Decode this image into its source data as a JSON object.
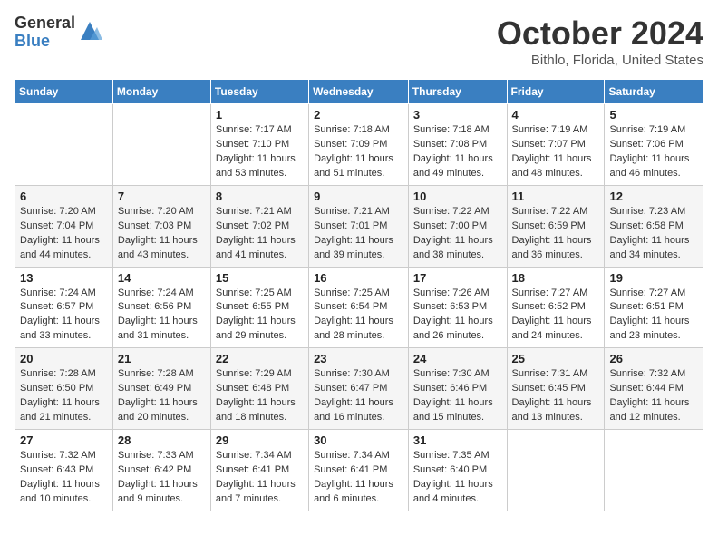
{
  "logo": {
    "general": "General",
    "blue": "Blue"
  },
  "title": {
    "month": "October 2024",
    "location": "Bithlo, Florida, United States"
  },
  "weekdays": [
    "Sunday",
    "Monday",
    "Tuesday",
    "Wednesday",
    "Thursday",
    "Friday",
    "Saturday"
  ],
  "weeks": [
    [
      {
        "day": "",
        "sunrise": "",
        "sunset": "",
        "daylight": ""
      },
      {
        "day": "",
        "sunrise": "",
        "sunset": "",
        "daylight": ""
      },
      {
        "day": "1",
        "sunrise": "Sunrise: 7:17 AM",
        "sunset": "Sunset: 7:10 PM",
        "daylight": "Daylight: 11 hours and 53 minutes."
      },
      {
        "day": "2",
        "sunrise": "Sunrise: 7:18 AM",
        "sunset": "Sunset: 7:09 PM",
        "daylight": "Daylight: 11 hours and 51 minutes."
      },
      {
        "day": "3",
        "sunrise": "Sunrise: 7:18 AM",
        "sunset": "Sunset: 7:08 PM",
        "daylight": "Daylight: 11 hours and 49 minutes."
      },
      {
        "day": "4",
        "sunrise": "Sunrise: 7:19 AM",
        "sunset": "Sunset: 7:07 PM",
        "daylight": "Daylight: 11 hours and 48 minutes."
      },
      {
        "day": "5",
        "sunrise": "Sunrise: 7:19 AM",
        "sunset": "Sunset: 7:06 PM",
        "daylight": "Daylight: 11 hours and 46 minutes."
      }
    ],
    [
      {
        "day": "6",
        "sunrise": "Sunrise: 7:20 AM",
        "sunset": "Sunset: 7:04 PM",
        "daylight": "Daylight: 11 hours and 44 minutes."
      },
      {
        "day": "7",
        "sunrise": "Sunrise: 7:20 AM",
        "sunset": "Sunset: 7:03 PM",
        "daylight": "Daylight: 11 hours and 43 minutes."
      },
      {
        "day": "8",
        "sunrise": "Sunrise: 7:21 AM",
        "sunset": "Sunset: 7:02 PM",
        "daylight": "Daylight: 11 hours and 41 minutes."
      },
      {
        "day": "9",
        "sunrise": "Sunrise: 7:21 AM",
        "sunset": "Sunset: 7:01 PM",
        "daylight": "Daylight: 11 hours and 39 minutes."
      },
      {
        "day": "10",
        "sunrise": "Sunrise: 7:22 AM",
        "sunset": "Sunset: 7:00 PM",
        "daylight": "Daylight: 11 hours and 38 minutes."
      },
      {
        "day": "11",
        "sunrise": "Sunrise: 7:22 AM",
        "sunset": "Sunset: 6:59 PM",
        "daylight": "Daylight: 11 hours and 36 minutes."
      },
      {
        "day": "12",
        "sunrise": "Sunrise: 7:23 AM",
        "sunset": "Sunset: 6:58 PM",
        "daylight": "Daylight: 11 hours and 34 minutes."
      }
    ],
    [
      {
        "day": "13",
        "sunrise": "Sunrise: 7:24 AM",
        "sunset": "Sunset: 6:57 PM",
        "daylight": "Daylight: 11 hours and 33 minutes."
      },
      {
        "day": "14",
        "sunrise": "Sunrise: 7:24 AM",
        "sunset": "Sunset: 6:56 PM",
        "daylight": "Daylight: 11 hours and 31 minutes."
      },
      {
        "day": "15",
        "sunrise": "Sunrise: 7:25 AM",
        "sunset": "Sunset: 6:55 PM",
        "daylight": "Daylight: 11 hours and 29 minutes."
      },
      {
        "day": "16",
        "sunrise": "Sunrise: 7:25 AM",
        "sunset": "Sunset: 6:54 PM",
        "daylight": "Daylight: 11 hours and 28 minutes."
      },
      {
        "day": "17",
        "sunrise": "Sunrise: 7:26 AM",
        "sunset": "Sunset: 6:53 PM",
        "daylight": "Daylight: 11 hours and 26 minutes."
      },
      {
        "day": "18",
        "sunrise": "Sunrise: 7:27 AM",
        "sunset": "Sunset: 6:52 PM",
        "daylight": "Daylight: 11 hours and 24 minutes."
      },
      {
        "day": "19",
        "sunrise": "Sunrise: 7:27 AM",
        "sunset": "Sunset: 6:51 PM",
        "daylight": "Daylight: 11 hours and 23 minutes."
      }
    ],
    [
      {
        "day": "20",
        "sunrise": "Sunrise: 7:28 AM",
        "sunset": "Sunset: 6:50 PM",
        "daylight": "Daylight: 11 hours and 21 minutes."
      },
      {
        "day": "21",
        "sunrise": "Sunrise: 7:28 AM",
        "sunset": "Sunset: 6:49 PM",
        "daylight": "Daylight: 11 hours and 20 minutes."
      },
      {
        "day": "22",
        "sunrise": "Sunrise: 7:29 AM",
        "sunset": "Sunset: 6:48 PM",
        "daylight": "Daylight: 11 hours and 18 minutes."
      },
      {
        "day": "23",
        "sunrise": "Sunrise: 7:30 AM",
        "sunset": "Sunset: 6:47 PM",
        "daylight": "Daylight: 11 hours and 16 minutes."
      },
      {
        "day": "24",
        "sunrise": "Sunrise: 7:30 AM",
        "sunset": "Sunset: 6:46 PM",
        "daylight": "Daylight: 11 hours and 15 minutes."
      },
      {
        "day": "25",
        "sunrise": "Sunrise: 7:31 AM",
        "sunset": "Sunset: 6:45 PM",
        "daylight": "Daylight: 11 hours and 13 minutes."
      },
      {
        "day": "26",
        "sunrise": "Sunrise: 7:32 AM",
        "sunset": "Sunset: 6:44 PM",
        "daylight": "Daylight: 11 hours and 12 minutes."
      }
    ],
    [
      {
        "day": "27",
        "sunrise": "Sunrise: 7:32 AM",
        "sunset": "Sunset: 6:43 PM",
        "daylight": "Daylight: 11 hours and 10 minutes."
      },
      {
        "day": "28",
        "sunrise": "Sunrise: 7:33 AM",
        "sunset": "Sunset: 6:42 PM",
        "daylight": "Daylight: 11 hours and 9 minutes."
      },
      {
        "day": "29",
        "sunrise": "Sunrise: 7:34 AM",
        "sunset": "Sunset: 6:41 PM",
        "daylight": "Daylight: 11 hours and 7 minutes."
      },
      {
        "day": "30",
        "sunrise": "Sunrise: 7:34 AM",
        "sunset": "Sunset: 6:41 PM",
        "daylight": "Daylight: 11 hours and 6 minutes."
      },
      {
        "day": "31",
        "sunrise": "Sunrise: 7:35 AM",
        "sunset": "Sunset: 6:40 PM",
        "daylight": "Daylight: 11 hours and 4 minutes."
      },
      {
        "day": "",
        "sunrise": "",
        "sunset": "",
        "daylight": ""
      },
      {
        "day": "",
        "sunrise": "",
        "sunset": "",
        "daylight": ""
      }
    ]
  ]
}
